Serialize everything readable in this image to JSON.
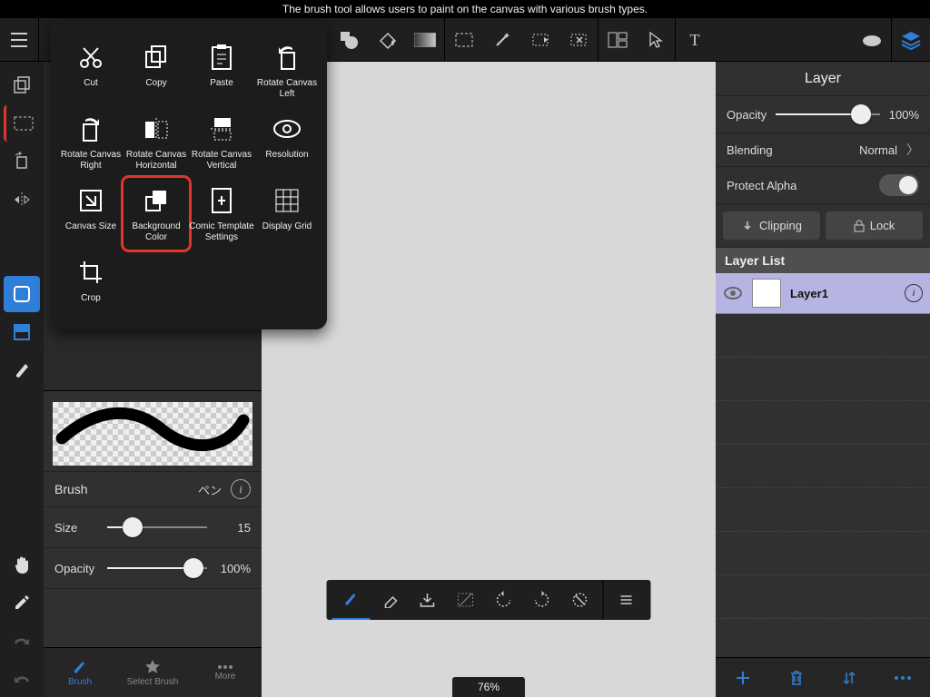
{
  "tooltip": "The brush tool allows users to paint on the canvas with various brush types.",
  "topbar": {
    "items": [
      {
        "name": "hamburger-icon"
      },
      {
        "name": "duplicate-icon"
      },
      {
        "name": "selection-dashed-icon"
      },
      {
        "name": "rotate-icon"
      },
      {
        "name": "flip-horizontal-icon"
      }
    ]
  },
  "zoom": "76%",
  "menu": {
    "cut": "Cut",
    "copy": "Copy",
    "paste": "Paste",
    "rotate_left": "Rotate Canvas Left",
    "rotate_right": "Rotate Canvas Right",
    "rotate_h": "Rotate Canvas Horizontal",
    "rotate_v": "Rotate Canvas Vertical",
    "resolution": "Resolution",
    "canvas_size": "Canvas Size",
    "bg_color": "Background Color",
    "comic": "Comic Template Settings",
    "grid": "Display Grid",
    "crop": "Crop"
  },
  "brush": {
    "title": "Brush",
    "sub": "ペン",
    "size_label": "Size",
    "size_value": "15",
    "size_pct": 25,
    "opacity_label": "Opacity",
    "opacity_value": "100%",
    "opacity_pct": 86,
    "tabs": {
      "brush": "Brush",
      "select": "Select Brush",
      "more": "More"
    }
  },
  "layer": {
    "title": "Layer",
    "opacity_label": "Opacity",
    "opacity_value": "100%",
    "opacity_pct": 82,
    "blending_label": "Blending",
    "blending_value": "Normal",
    "protect_label": "Protect Alpha",
    "clipping": "Clipping",
    "lock": "Lock",
    "list_header": "Layer List",
    "layer1": "Layer1"
  }
}
